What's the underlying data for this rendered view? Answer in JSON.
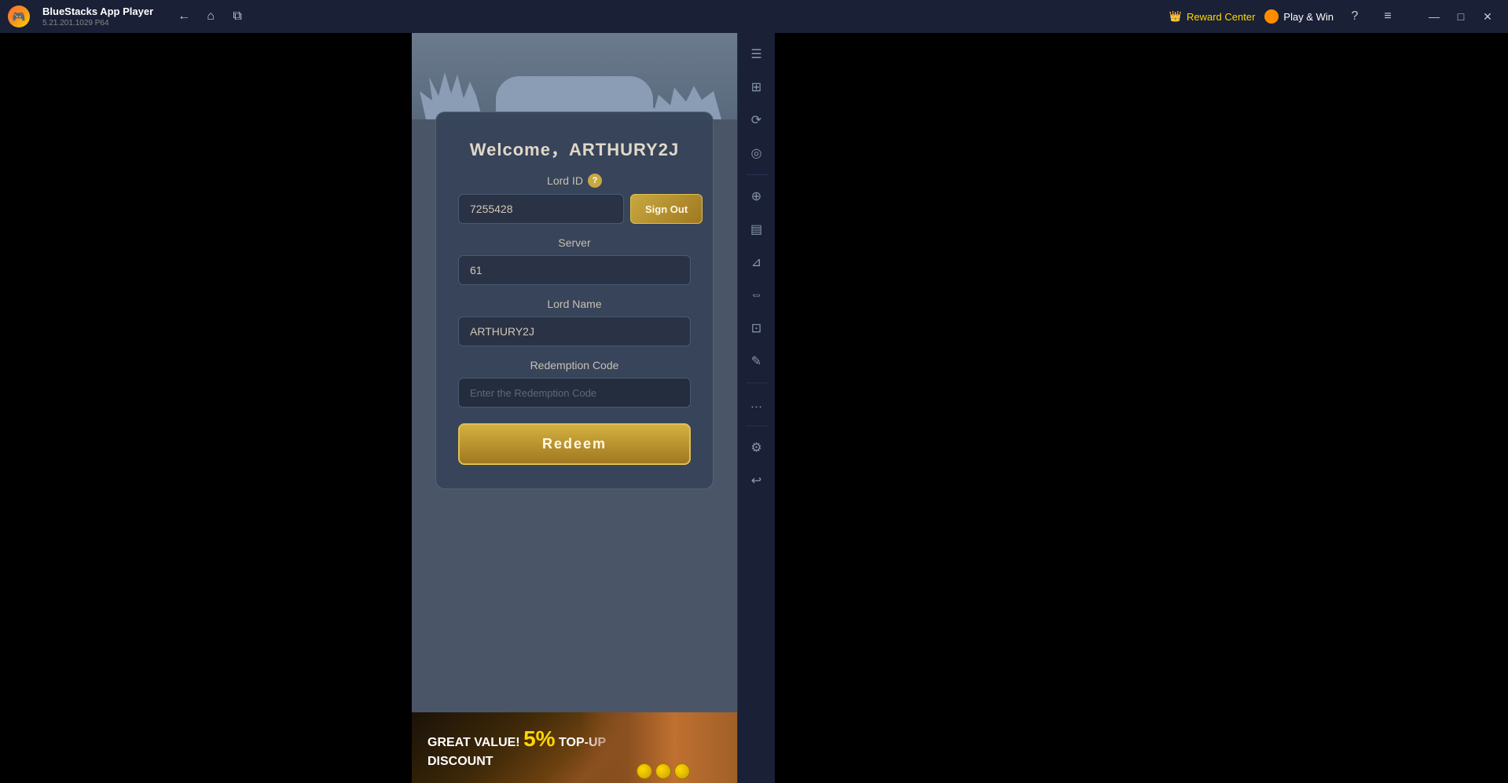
{
  "titlebar": {
    "app_name": "BlueStacks App Player",
    "version": "5.21.201.1029  P64",
    "logo_icon": "🎮",
    "nav_back": "←",
    "nav_home": "⌂",
    "nav_multi": "⧉",
    "reward_center": "Reward Center",
    "play_win": "Play & Win",
    "help": "?",
    "menu": "≡",
    "minimize": "—",
    "maximize": "□",
    "close": "✕"
  },
  "sidebar_right": {
    "icons": [
      "☰",
      "⊞",
      "⟳",
      "◎",
      "⊕",
      "▤",
      "⊿",
      "⇔",
      "⊡",
      "✎",
      "…",
      "⚙",
      "↩"
    ]
  },
  "game": {
    "welcome_text": "Welcome，ARTHURY2J",
    "lord_id_label": "Lord ID",
    "lord_id_value": "7255428",
    "sign_out_label": "Sign Out",
    "server_label": "Server",
    "server_value": "61",
    "lord_name_label": "Lord Name",
    "lord_name_value": "ARTHURY2J",
    "redemption_code_label": "Redemption Code",
    "redemption_code_placeholder": "Enter the Redemption Code",
    "redeem_button": "Redeem",
    "banner_line1": "GREAT",
    "banner_line2": "VALUE!",
    "banner_percent": "5%",
    "banner_line3": "TOP-UP",
    "banner_line4": "DISCOUNT"
  }
}
